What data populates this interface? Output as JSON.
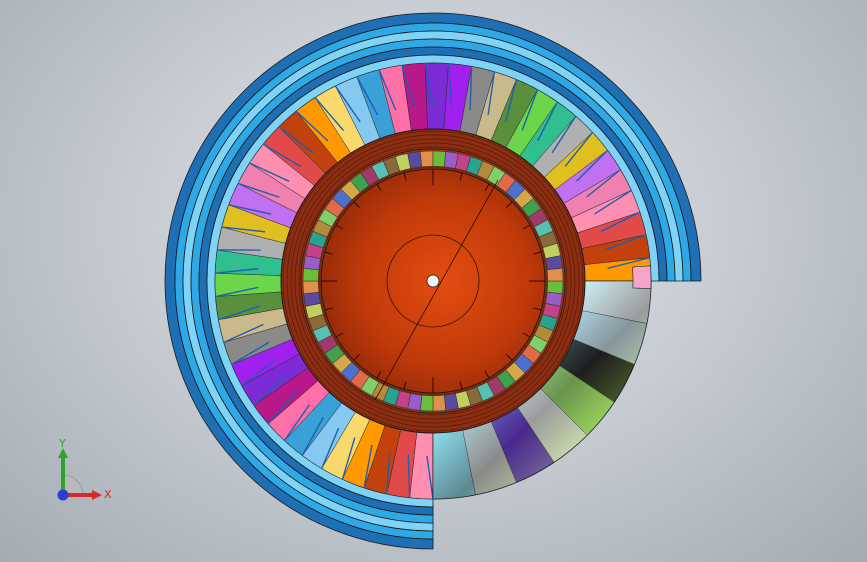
{
  "viewport": {
    "model": "rotor-assembly",
    "colors": {
      "background_center": "#dfe3e8",
      "background_edge": "#a4abb3",
      "outer_ring": "#2fa8e6",
      "outer_ring_light": "#7fd3f7",
      "outer_ring_dark": "#1e6fb3",
      "hub": "#c83a0a",
      "hub_dark": "#8a2606",
      "rim": "#8c2e12",
      "edge": "#1a1a1a"
    },
    "outer_blade_palette": [
      "#ff8fb0",
      "#e24a4a",
      "#c2410c",
      "#ff9900",
      "#f9d96b",
      "#86c9f0",
      "#3aa0d8",
      "#ff6fa8",
      "#b9188a",
      "#7c2bd6",
      "#a020f0",
      "#8a8a8a",
      "#c9b98b",
      "#5a8f3c",
      "#6bd64a",
      "#30c090",
      "#b0b0b0",
      "#e0c020",
      "#c070f0",
      "#f080b0"
    ],
    "inner_blade_palette": [
      "#6bbd3a",
      "#9a5cc8",
      "#c4428c",
      "#2aa38e",
      "#b48a3c",
      "#7fd06a",
      "#e06a4a",
      "#4c6fd0",
      "#d4a84a",
      "#3fa050",
      "#a03a6a",
      "#58c0b0",
      "#8a6a3a",
      "#c0d060",
      "#5a4aa0",
      "#e0904a"
    ]
  },
  "triad": {
    "x_label": "X",
    "y_label": "Y",
    "x_color": "#d42a2a",
    "y_color": "#2aa52a",
    "z_color": "#2a3fd4"
  }
}
